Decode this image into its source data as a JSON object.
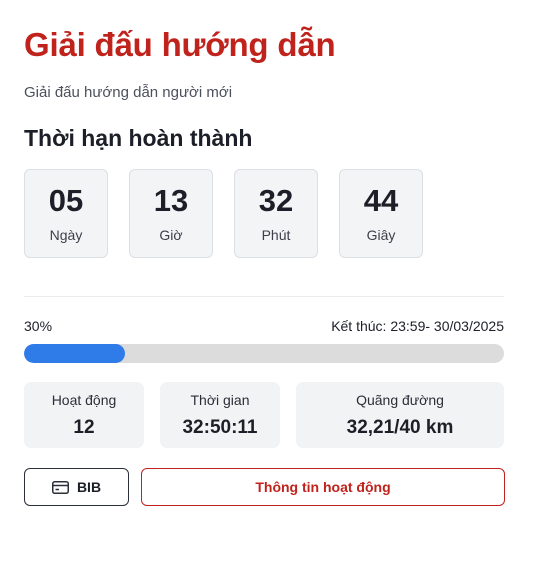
{
  "header": {
    "title": "Giải đấu hướng dẫn",
    "subtitle": "Giải đấu hướng dẫn người mới"
  },
  "deadline": {
    "title": "Thời hạn hoàn thành",
    "countdown": [
      {
        "value": "05",
        "unit": "Ngày"
      },
      {
        "value": "13",
        "unit": "Giờ"
      },
      {
        "value": "32",
        "unit": "Phút"
      },
      {
        "value": "44",
        "unit": "Giây"
      }
    ]
  },
  "progress": {
    "percent_label": "30%",
    "percent": 0.21,
    "end_label": "Kết thúc: 23:59- 30/03/2025",
    "fill_color": "#2f7be8"
  },
  "stats": [
    {
      "label": "Hoạt động",
      "value": "12"
    },
    {
      "label": "Thời gian",
      "value": "32:50:11"
    },
    {
      "label": "Quãng đường",
      "value": "32,21/40 km"
    }
  ],
  "actions": {
    "bib_label": "BIB",
    "bib_icon": "credit-card-icon",
    "info_label": "Thông tin hoạt động"
  },
  "colors": {
    "brand": "#c0221c",
    "accent": "#2f7be8"
  }
}
